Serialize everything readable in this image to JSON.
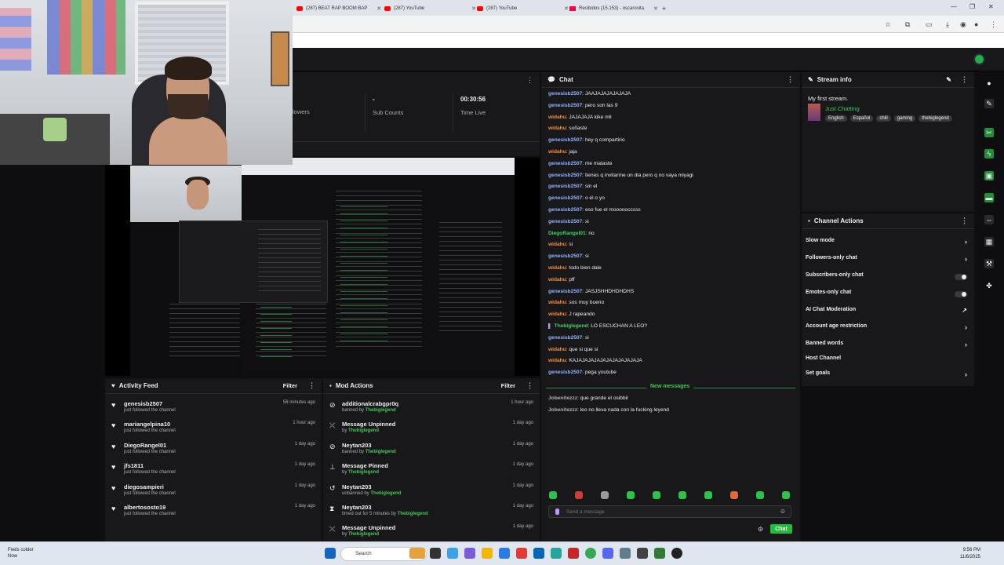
{
  "browser": {
    "tabs": [
      {
        "label": "(287) BEAT RAP BOOM BAP",
        "icon": "youtube-icon"
      },
      {
        "label": "(287) YouTube",
        "icon": "youtube-icon"
      },
      {
        "label": "(287) YouTube",
        "icon": "youtube-icon"
      },
      {
        "label": "Recibidos (15.153) - oscarosita",
        "icon": "gmail-icon"
      }
    ],
    "new_tab": "+",
    "window_controls": [
      "—",
      "❐",
      "✕"
    ]
  },
  "stats": {
    "followers_value": "",
    "followers_label": "lowers",
    "subs_value": "-",
    "subs_label": "Sub Counts",
    "time_value": "00:30:56",
    "time_label": "Time Live"
  },
  "activity_feed": {
    "title": "Activity Feed",
    "filter": "Filter",
    "items": [
      {
        "name": "genesisb2507",
        "detail": "just followed the channel",
        "time": "58 minutes ago"
      },
      {
        "name": "mariangelpina10",
        "detail": "just followed the channel",
        "time": "1 hour ago"
      },
      {
        "name": "DiegoRangel01",
        "detail": "just followed the channel",
        "time": "1 day ago"
      },
      {
        "name": "jfs1811",
        "detail": "just followed the channel",
        "time": "1 day ago"
      },
      {
        "name": "diegosampieri",
        "detail": "just followed the channel",
        "time": "1 day ago"
      },
      {
        "name": "albertososto19",
        "detail": "just followed the channel",
        "time": "1 day ago"
      }
    ]
  },
  "mod_actions": {
    "title": "Mod Actions",
    "filter": "Filter",
    "items": [
      {
        "title": "additionalcrabgpr0q",
        "prefix": "banned by",
        "by": "Thebiglegend",
        "time": "1 hour ago",
        "icon": "ban-icon"
      },
      {
        "title": "Message Unpinned",
        "prefix": "by",
        "by": "Thebiglegend",
        "time": "1 day ago",
        "icon": "unpin-icon"
      },
      {
        "title": "Neytan203",
        "prefix": "banned by",
        "by": "Thebiglegend",
        "time": "1 day ago",
        "icon": "ban-icon"
      },
      {
        "title": "Message Pinned",
        "prefix": "by",
        "by": "Thebiglegend",
        "time": "1 day ago",
        "icon": "pin-icon"
      },
      {
        "title": "Neytan203",
        "prefix": "unbanned by",
        "by": "Thebiglegend",
        "time": "1 day ago",
        "icon": "unban-icon"
      },
      {
        "title": "Neytan203",
        "prefix": "timed out for 5 minutes by",
        "by": "Thebiglegend",
        "time": "1 day ago",
        "icon": "timeout-icon"
      },
      {
        "title": "Message Unpinned",
        "prefix": "by",
        "by": "Thebiglegend",
        "time": "1 day ago",
        "icon": "unpin-icon"
      }
    ]
  },
  "chat": {
    "title": "Chat",
    "messages": [
      {
        "user": "genesisb2507",
        "color": "#8fb2ff",
        "text": "JAAJAJAJAJAJAJA"
      },
      {
        "user": "genesisb2507",
        "color": "#8fb2ff",
        "text": "pero son las 9"
      },
      {
        "user": "widahu",
        "color": "#ff8c3a",
        "text": "JAJAJAJA kike mil"
      },
      {
        "user": "widahu",
        "color": "#ff8c3a",
        "text": "soñaste"
      },
      {
        "user": "genesisb2507",
        "color": "#8fb2ff",
        "text": "hey q compartirio"
      },
      {
        "user": "widahu",
        "color": "#ff8c3a",
        "text": "jaja"
      },
      {
        "user": "genesisb2507",
        "color": "#8fb2ff",
        "text": "me mataste"
      },
      {
        "user": "genesisb2507",
        "color": "#8fb2ff",
        "text": "tienes q invitarme un dia pero q no vaya miyagi"
      },
      {
        "user": "genesisb2507",
        "color": "#8fb2ff",
        "text": "sin el"
      },
      {
        "user": "genesisb2507",
        "color": "#8fb2ff",
        "text": "o él o yo"
      },
      {
        "user": "genesisb2507",
        "color": "#8fb2ff",
        "text": "eso fue el moooooccsss"
      },
      {
        "user": "genesisb2507",
        "color": "#8fb2ff",
        "text": "si"
      },
      {
        "user": "DiegoRangel01",
        "color": "#3fd45a",
        "text": "no"
      },
      {
        "user": "widahu",
        "color": "#ff8c3a",
        "text": "si"
      },
      {
        "user": "genesisb2507",
        "color": "#8fb2ff",
        "text": "si"
      },
      {
        "user": "widahu",
        "color": "#ff8c3a",
        "text": "todo bien dale"
      },
      {
        "user": "widahu",
        "color": "#ff8c3a",
        "text": "pff"
      },
      {
        "user": "genesisb2507",
        "color": "#8fb2ff",
        "text": "JASJSHHDHDHDHS"
      },
      {
        "user": "widahu",
        "color": "#ff8c3a",
        "text": "sos muy bueno"
      },
      {
        "user": "widahu",
        "color": "#ff8c3a",
        "text": "J rapeando"
      },
      {
        "user": "Thebiglegend",
        "color": "#3fd45a",
        "text": "LO ESCUCHAN A LEO?",
        "badge": true
      },
      {
        "user": "genesisb2507",
        "color": "#8fb2ff",
        "text": "si"
      },
      {
        "user": "widahu",
        "color": "#ff8c3a",
        "text": "que si que si"
      },
      {
        "user": "widahu",
        "color": "#ff8c3a",
        "text": "KAJAJAJAJAJAJAJAJAJAJAJA"
      },
      {
        "user": "genesisb2507",
        "color": "#8fb2ff",
        "text": "pega youtube"
      }
    ],
    "new_messages_label": "New messages",
    "new_messages": [
      {
        "user": "Jobenitezzz",
        "color": "#adadb8",
        "text": "que grande el osibbil"
      },
      {
        "user": "Jobenitezzz",
        "color": "#adadb8",
        "text": "leo no lleva nada con la fucking leyend"
      }
    ],
    "input_placeholder": "Send a message",
    "send_label": "Chat"
  },
  "stream_info": {
    "title": "Stream info",
    "stream_title": "My first stream.",
    "category": "Just Chatting",
    "tags": [
      "English",
      "Español",
      "chill",
      "gaming",
      "thebiglegend"
    ]
  },
  "channel_actions": {
    "title": "Channel Actions",
    "items": [
      {
        "label": "Slow mode",
        "control": "chevron"
      },
      {
        "label": "Followers-only chat",
        "control": "chevron"
      },
      {
        "label": "Subscribers-only chat",
        "control": "toggle"
      },
      {
        "label": "Emotes-only chat",
        "control": "toggle"
      },
      {
        "label": "AI Chat Moderation",
        "control": "external"
      },
      {
        "label": "Account age restriction",
        "control": "chevron"
      },
      {
        "label": "Banned words",
        "control": "chevron"
      },
      {
        "label": "Host Channel",
        "control": "none"
      },
      {
        "label": "Set goals",
        "control": "chevron"
      }
    ]
  },
  "taskbar": {
    "weather_line1": "Feels colder",
    "weather_line2": "Now",
    "search_placeholder": "Search",
    "time": "9:56 PM",
    "date": "11/6/2025"
  }
}
